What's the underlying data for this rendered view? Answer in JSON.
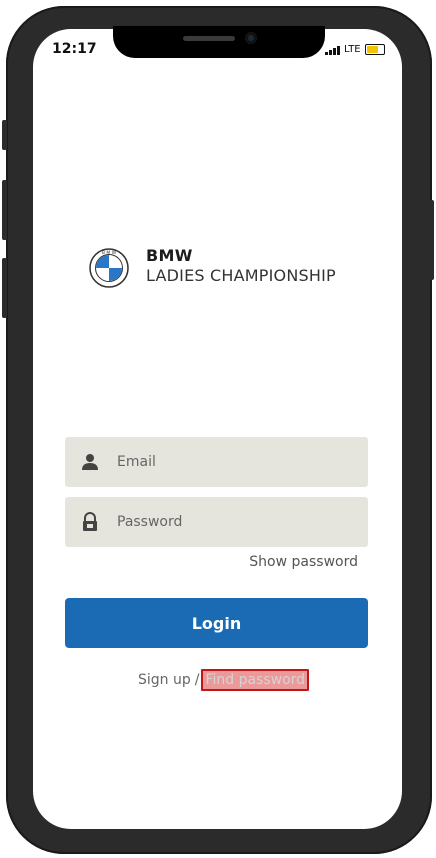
{
  "status_bar": {
    "time": "12:17",
    "network": "LTE"
  },
  "brand": {
    "line1": "BMW",
    "line2": "LADIES CHAMPIONSHIP"
  },
  "form": {
    "email_placeholder": "Email",
    "password_placeholder": "Password",
    "show_password": "Show password",
    "login_label": "Login"
  },
  "links": {
    "signup": "Sign up",
    "separator": "/",
    "find_password": "Find password"
  },
  "colors": {
    "login_button": "#1a6bb4",
    "field_bg": "#e5e5de",
    "highlight": "#c01818"
  },
  "icons": {
    "email": "user-icon",
    "password": "lock-icon",
    "logo": "bmw-logo"
  }
}
